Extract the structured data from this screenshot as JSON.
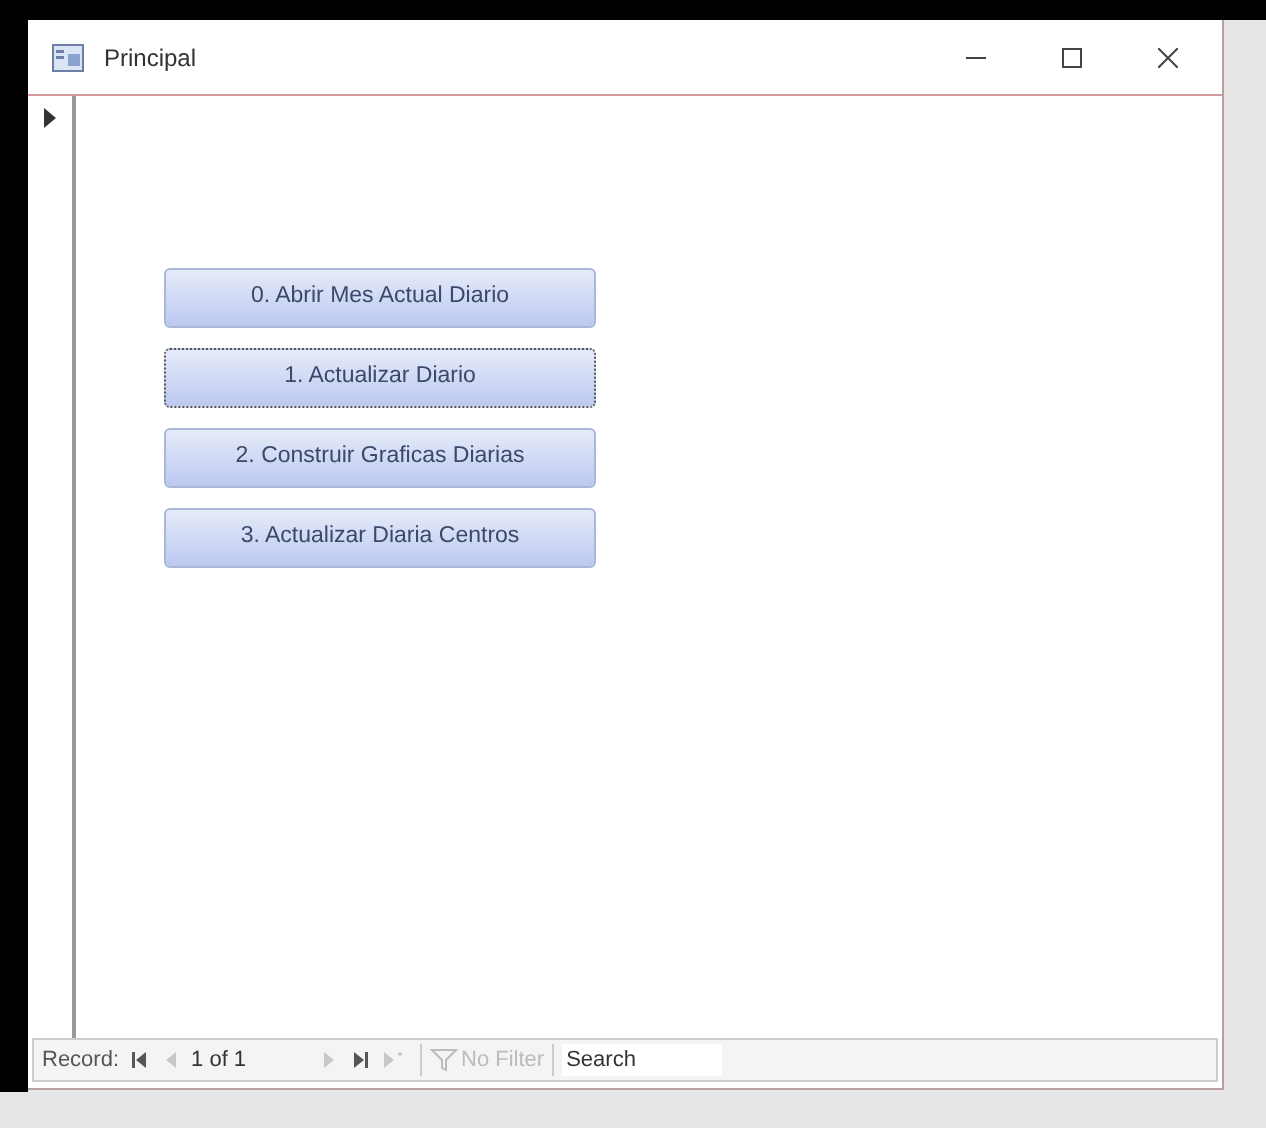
{
  "window": {
    "title": "Principal"
  },
  "buttons": [
    {
      "label": "0. Abrir Mes Actual Diario",
      "focused": false
    },
    {
      "label": "1. Actualizar Diario",
      "focused": true
    },
    {
      "label": "2. Construir Graficas Diarias",
      "focused": false
    },
    {
      "label": "3. Actualizar Diaria Centros",
      "focused": false
    }
  ],
  "navigation": {
    "label": "Record:",
    "position": "1 of 1",
    "nav_buttons": [
      {
        "kind": "first",
        "disabled": false
      },
      {
        "kind": "previous",
        "disabled": true
      },
      {
        "kind": "next",
        "disabled": true
      },
      {
        "kind": "last",
        "disabled": false
      },
      {
        "kind": "new",
        "disabled": true
      }
    ],
    "filter": {
      "label": "No Filter",
      "disabled": true
    },
    "search": {
      "placeholder": "Search"
    }
  }
}
